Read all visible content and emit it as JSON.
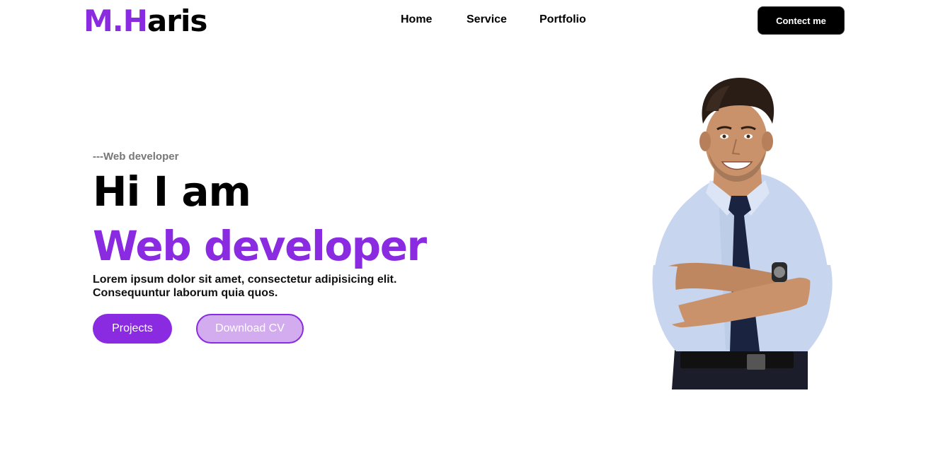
{
  "header": {
    "logo_accent": "M.H",
    "logo_rest": "aris",
    "nav": [
      {
        "label": "Home"
      },
      {
        "label": "Service"
      },
      {
        "label": "Portfolio"
      }
    ],
    "contact_label": "Contect me"
  },
  "hero": {
    "subtitle": "---Web developer",
    "heading": "Hi I am",
    "role": "Web developer",
    "description": "Lorem ipsum dolor sit amet, consectetur adipisicing elit. Consequuntur laborum quia quos.",
    "projects_label": "Projects",
    "download_label": "Download CV"
  },
  "colors": {
    "accent": "#8a2be2",
    "accent_light": "#d3acf0",
    "text": "#000000",
    "muted": "#777777",
    "background": "#ffffff"
  }
}
